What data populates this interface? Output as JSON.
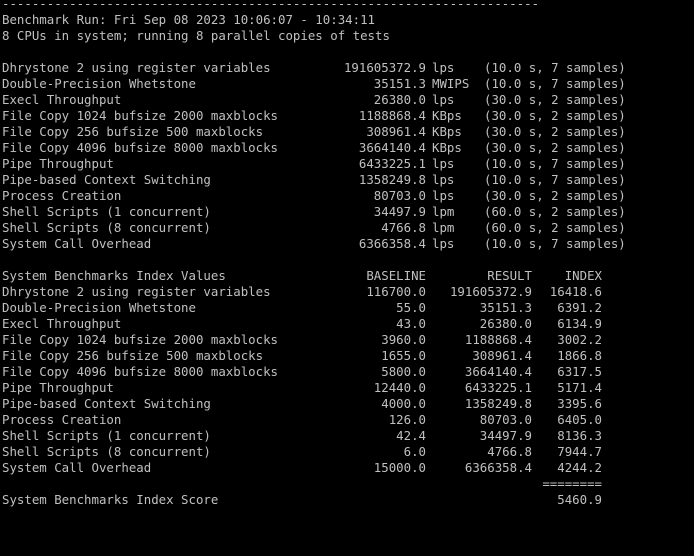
{
  "header": {
    "rule": "------------------------------------------------------------------------",
    "run": "Benchmark Run: Fri Sep 08 2023 10:06:07 - 10:34:11",
    "cpus": "8 CPUs in system; running 8 parallel copies of tests"
  },
  "results": [
    {
      "name": "Dhrystone 2 using register variables",
      "value": "191605372.9",
      "unit": "lps",
      "samples": "(10.0 s, 7 samples)"
    },
    {
      "name": "Double-Precision Whetstone",
      "value": "35151.3",
      "unit": "MWIPS",
      "samples": "(10.0 s, 7 samples)"
    },
    {
      "name": "Execl Throughput",
      "value": "26380.0",
      "unit": "lps",
      "samples": "(30.0 s, 2 samples)"
    },
    {
      "name": "File Copy 1024 bufsize 2000 maxblocks",
      "value": "1188868.4",
      "unit": "KBps",
      "samples": "(30.0 s, 2 samples)"
    },
    {
      "name": "File Copy 256 bufsize 500 maxblocks",
      "value": "308961.4",
      "unit": "KBps",
      "samples": "(30.0 s, 2 samples)"
    },
    {
      "name": "File Copy 4096 bufsize 8000 maxblocks",
      "value": "3664140.4",
      "unit": "KBps",
      "samples": "(30.0 s, 2 samples)"
    },
    {
      "name": "Pipe Throughput",
      "value": "6433225.1",
      "unit": "lps",
      "samples": "(10.0 s, 7 samples)"
    },
    {
      "name": "Pipe-based Context Switching",
      "value": "1358249.8",
      "unit": "lps",
      "samples": "(10.0 s, 7 samples)"
    },
    {
      "name": "Process Creation",
      "value": "80703.0",
      "unit": "lps",
      "samples": "(30.0 s, 2 samples)"
    },
    {
      "name": "Shell Scripts (1 concurrent)",
      "value": "34497.9",
      "unit": "lpm",
      "samples": "(60.0 s, 2 samples)"
    },
    {
      "name": "Shell Scripts (8 concurrent)",
      "value": "4766.8",
      "unit": "lpm",
      "samples": "(60.0 s, 2 samples)"
    },
    {
      "name": "System Call Overhead",
      "value": "6366358.4",
      "unit": "lps",
      "samples": "(10.0 s, 7 samples)"
    }
  ],
  "index": {
    "title": "System Benchmarks Index Values",
    "baseline_header": "BASELINE",
    "result_header": "RESULT",
    "index_header": "INDEX",
    "rows": [
      {
        "name": "Dhrystone 2 using register variables",
        "baseline": "116700.0",
        "result": "191605372.9",
        "index": "16418.6"
      },
      {
        "name": "Double-Precision Whetstone",
        "baseline": "55.0",
        "result": "35151.3",
        "index": "6391.2"
      },
      {
        "name": "Execl Throughput",
        "baseline": "43.0",
        "result": "26380.0",
        "index": "6134.9"
      },
      {
        "name": "File Copy 1024 bufsize 2000 maxblocks",
        "baseline": "3960.0",
        "result": "1188868.4",
        "index": "3002.2"
      },
      {
        "name": "File Copy 256 bufsize 500 maxblocks",
        "baseline": "1655.0",
        "result": "308961.4",
        "index": "1866.8"
      },
      {
        "name": "File Copy 4096 bufsize 8000 maxblocks",
        "baseline": "5800.0",
        "result": "3664140.4",
        "index": "6317.5"
      },
      {
        "name": "Pipe Throughput",
        "baseline": "12440.0",
        "result": "6433225.1",
        "index": "5171.4"
      },
      {
        "name": "Pipe-based Context Switching",
        "baseline": "4000.0",
        "result": "1358249.8",
        "index": "3395.6"
      },
      {
        "name": "Process Creation",
        "baseline": "126.0",
        "result": "80703.0",
        "index": "6405.0"
      },
      {
        "name": "Shell Scripts (1 concurrent)",
        "baseline": "42.4",
        "result": "34497.9",
        "index": "8136.3"
      },
      {
        "name": "Shell Scripts (8 concurrent)",
        "baseline": "6.0",
        "result": "4766.8",
        "index": "7944.7"
      },
      {
        "name": "System Call Overhead",
        "baseline": "15000.0",
        "result": "6366358.4",
        "index": "4244.2"
      }
    ],
    "separator": "========",
    "score_label": "System Benchmarks Index Score",
    "score": "5460.9"
  }
}
